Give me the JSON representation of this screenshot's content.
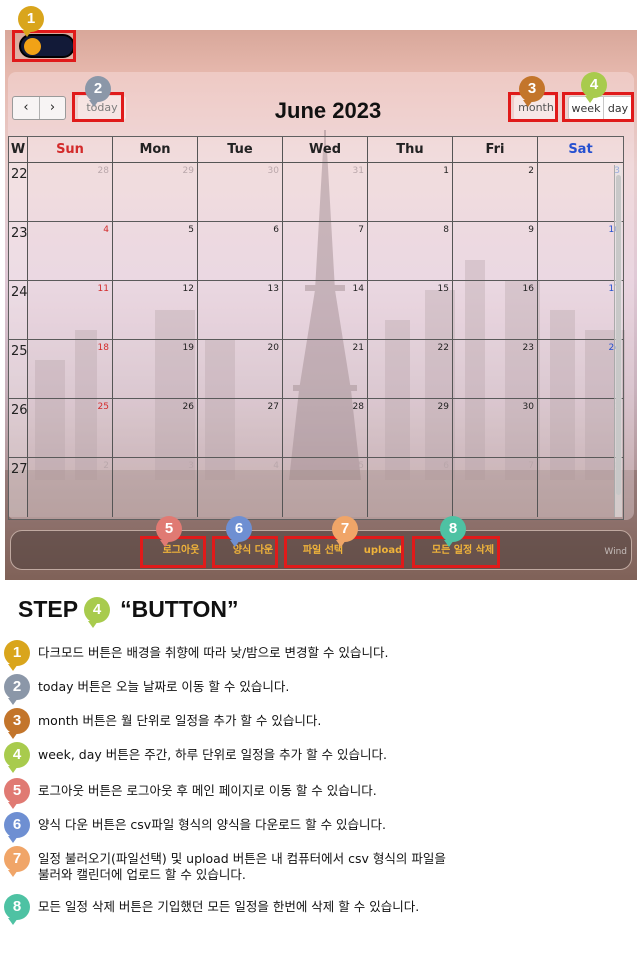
{
  "screenshot": {
    "dark_toggle": {
      "icon": "moon-sun-toggle-icon"
    },
    "toolbar": {
      "prev_label": "‹",
      "next_label": "›",
      "today_label": "today",
      "title": "June 2023",
      "month_label": "month",
      "week_label": "week",
      "day_label": "day"
    },
    "calendar": {
      "headers": [
        "W",
        "Sun",
        "Mon",
        "Tue",
        "Wed",
        "Thu",
        "Fri",
        "Sat"
      ],
      "weeks": [
        {
          "week": "22",
          "days": [
            "28",
            "29",
            "30",
            "31",
            "1",
            "2",
            "3"
          ]
        },
        {
          "week": "23",
          "days": [
            "4",
            "5",
            "6",
            "7",
            "8",
            "9",
            "10"
          ]
        },
        {
          "week": "24",
          "days": [
            "11",
            "12",
            "13",
            "14",
            "15",
            "16",
            "17"
          ]
        },
        {
          "week": "25",
          "days": [
            "18",
            "19",
            "20",
            "21",
            "22",
            "23",
            "24"
          ]
        },
        {
          "week": "26",
          "days": [
            "25",
            "26",
            "27",
            "28",
            "29",
            "30",
            "1"
          ]
        },
        {
          "week": "27",
          "days": [
            "2",
            "3",
            "4",
            "5",
            "6",
            "7",
            "8"
          ]
        }
      ]
    },
    "bottom_bar": {
      "logout_label": "로그아웃",
      "download_label": "양식 다운",
      "file_select_label": "파일 선택",
      "upload_label": "upload",
      "delete_all_label": "모든 일정 삭제",
      "windows_watermark": "Wind"
    }
  },
  "badges": [
    "1",
    "2",
    "3",
    "4",
    "5",
    "6",
    "7",
    "8"
  ],
  "heading": {
    "step_label": "STEP",
    "step_number": "4",
    "title": "“BUTTON”"
  },
  "descriptions": [
    {
      "number": "1",
      "text": "다크모드 버튼은 배경을 취향에 따라 낮/밤으로 변경할 수 있습니다."
    },
    {
      "number": "2",
      "text": "today 버튼은 오늘 날짜로 이동 할 수 있습니다."
    },
    {
      "number": "3",
      "text": "month 버튼은 월 단위로 일정을 추가 할 수 있습니다."
    },
    {
      "number": "4",
      "text": "week, day 버튼은 주간, 하루 단위로 일정을 추가 할 수 있습니다."
    },
    {
      "number": "5",
      "text": "로그아웃 버튼은 로그아웃 후 메인 페이지로 이동 할 수 있습니다."
    },
    {
      "number": "6",
      "text": "양식 다운 버튼은 csv파일 형식의 양식을 다운로드 할 수 있습니다."
    },
    {
      "number": "7",
      "text": "일정 불러오기(파일선택) 및 upload 버튼은 내 컴퓨터에서 csv 형식의 파일을\n불러와 캘린더에 업로드 할 수 있습니다."
    },
    {
      "number": "8",
      "text": "모든 일정 삭제 버튼은 기입했던 모든 일정을 한번에 삭제 할 수 있습니다."
    }
  ]
}
